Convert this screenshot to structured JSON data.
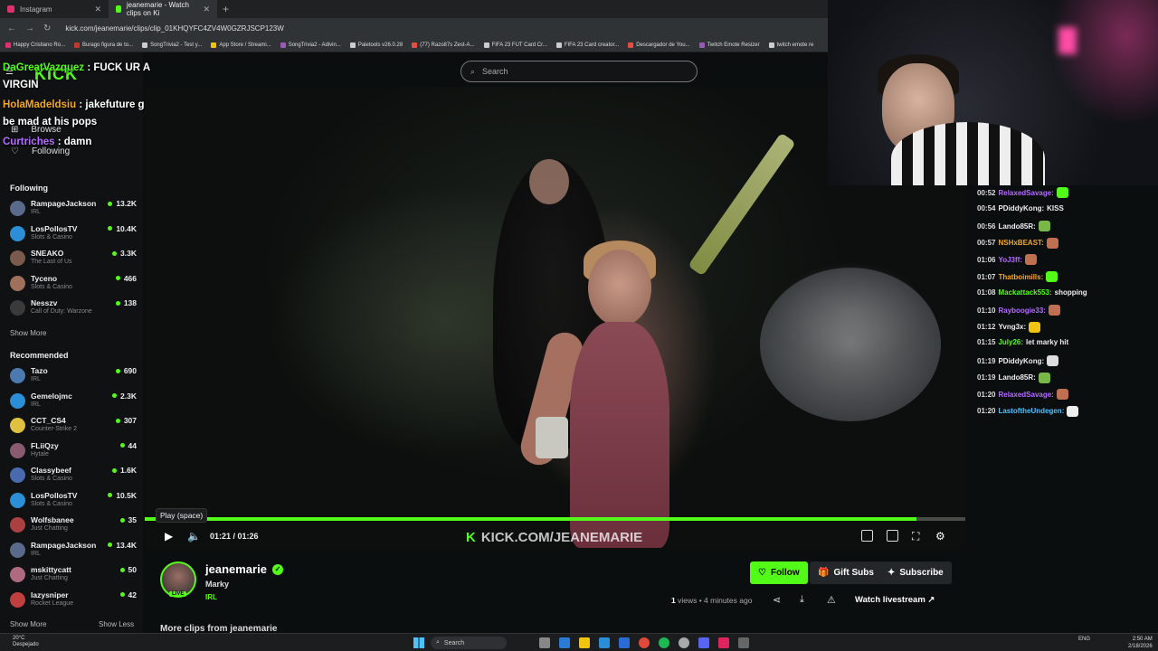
{
  "browser": {
    "tabs": [
      {
        "label": "Instagram",
        "color": "#e1306c"
      },
      {
        "label": "jeanemarie - Watch clips on Ki",
        "color": "#53fc18"
      }
    ],
    "url": "kick.com/jeanemarie/clips/clip_01KHQYFC4ZV4W0GZRJSCP123W",
    "bookmarks": [
      {
        "label": "Happy Cristiano Ro...",
        "color": "#e1306c"
      },
      {
        "label": "Burago figura de to...",
        "color": "#c0392b"
      },
      {
        "label": "SongTrivia2 - Test y...",
        "color": "#ccc"
      },
      {
        "label": "App Store / Streami...",
        "color": "#f1c40f"
      },
      {
        "label": "SongTrivia2 - Adivin...",
        "color": "#9b59b6"
      },
      {
        "label": "Paletools v26.0.28",
        "color": "#ccc"
      },
      {
        "label": "(77) Razo87s Zest-A...",
        "color": "#e74c3c"
      },
      {
        "label": "FIFA 23 FUT Card Cr...",
        "color": "#ccc"
      },
      {
        "label": "FIFA 23 Card creator...",
        "color": "#ccc"
      },
      {
        "label": "Descargador de You...",
        "color": "#e74c3c"
      },
      {
        "label": "Twitch Emote Resizer",
        "color": "#9b59b6"
      },
      {
        "label": "twitch emote re",
        "color": "#ccc"
      }
    ]
  },
  "overlay_chat": [
    {
      "user": "DaGreatVazquez",
      "text": " : FUCK UR A VIRGIN",
      "cls": "u1"
    },
    {
      "user": "HolaMadeldsiu",
      "text": " : jakefuture gonna be mad at his pops",
      "cls": "u2"
    },
    {
      "user": "Curtriches",
      "text": " : damn",
      "cls": "u3"
    }
  ],
  "sidebar": {
    "logo": "KICK",
    "browse": "Browse",
    "following_link": "Following",
    "following_title": "Following",
    "following": [
      {
        "name": "RampageJackson",
        "category": "IRL",
        "viewers": "13.2K",
        "color": "#5a6a8a"
      },
      {
        "name": "LosPollosTV",
        "category": "Slots & Casino",
        "viewers": "10.4K",
        "color": "#2a8fd6"
      },
      {
        "name": "SNEAKO",
        "category": "The Last of Us",
        "viewers": "3.3K",
        "color": "#7a5a4a"
      },
      {
        "name": "Tyceno",
        "category": "Slots & Casino",
        "viewers": "466",
        "color": "#a0705a"
      },
      {
        "name": "Nesszv",
        "category": "Call of Duty: Warzone",
        "viewers": "138",
        "color": "#3a3a3a"
      }
    ],
    "show_more": "Show More",
    "recommended_title": "Recommended",
    "recommended": [
      {
        "name": "Tazo",
        "category": "IRL",
        "viewers": "690",
        "color": "#4a7ab0"
      },
      {
        "name": "Gemelojmc",
        "category": "IRL",
        "viewers": "2.3K",
        "color": "#2a8fd6"
      },
      {
        "name": "CCT_CS4",
        "category": "Counter-Strike 2",
        "viewers": "307",
        "color": "#e0c040"
      },
      {
        "name": "FLiiQzy",
        "category": "Hytale",
        "viewers": "44",
        "color": "#8a5a70"
      },
      {
        "name": "Classybeef",
        "category": "Slots & Casino",
        "viewers": "1.6K",
        "color": "#4a6ab0"
      },
      {
        "name": "LosPollosTV",
        "category": "Slots & Casino",
        "viewers": "10.5K",
        "color": "#2a8fd6"
      },
      {
        "name": "Wolfsbanee",
        "category": "Just Chatting",
        "viewers": "35",
        "color": "#aa4040"
      },
      {
        "name": "RampageJackson",
        "category": "IRL",
        "viewers": "13.4K",
        "color": "#5a6a8a"
      },
      {
        "name": "mskittycatt",
        "category": "Just Chatting",
        "viewers": "50",
        "color": "#b06a80"
      },
      {
        "name": "lazysniper",
        "category": "Rocket League",
        "viewers": "42",
        "color": "#c04040"
      }
    ],
    "show_more2": "Show More",
    "show_less": "Show Less"
  },
  "search": {
    "placeholder": "Search"
  },
  "player": {
    "tooltip": "Play (space)",
    "time": "01:21 / 01:26",
    "progress_fraction": 0.94,
    "watermark": "KICK.COM/JEANEMARIE"
  },
  "channel": {
    "name": "jeanemarie",
    "clip_title": "Marky",
    "category": "IRL",
    "live_badge": "LIVE",
    "follow": "Follow",
    "gift": "Gift Subs",
    "subscribe": "Subscribe",
    "views_count": "1",
    "views_rest": " views • 4 minutes ago",
    "watch_live": "Watch livestream",
    "more_clips": "More clips from jeanemarie"
  },
  "chat": [
    {
      "time": "00:52",
      "user": "RelaxedSavage:",
      "text": "",
      "color": "#b46cff",
      "emote": "#53fc18"
    },
    {
      "time": "00:54",
      "user": "PDiddyKong:",
      "text": "KISS",
      "color": "#eee",
      "emote": ""
    },
    {
      "time": "00:56",
      "user": "Lando85R:",
      "text": "",
      "color": "#eee",
      "emote": "#7ab648"
    },
    {
      "time": "00:57",
      "user": "NSHxBEAST:",
      "text": "",
      "color": "#f4a724",
      "emote": "#c07050"
    },
    {
      "time": "01:06",
      "user": "YoJ3ff:",
      "text": "",
      "color": "#b46cff",
      "emote": "#c07050"
    },
    {
      "time": "01:07",
      "user": "Thatboimills:",
      "text": "",
      "color": "#f4a724",
      "emote": "#53fc18"
    },
    {
      "time": "01:08",
      "user": "Mackattack553:",
      "text": "shopping",
      "color": "#53fc18",
      "emote": ""
    },
    {
      "time": "01:10",
      "user": "Rayboogie33:",
      "text": "",
      "color": "#b46cff",
      "emote": "#c07050"
    },
    {
      "time": "01:12",
      "user": "Yvng3x:",
      "text": "",
      "color": "#eee",
      "emote": "#f1c40f"
    },
    {
      "time": "01:15",
      "user": "July26:",
      "text": "let marky hit",
      "color": "#53fc18",
      "emote": ""
    },
    {
      "time": "01:19",
      "user": "PDiddyKong:",
      "text": "",
      "color": "#eee",
      "emote": "#ddd"
    },
    {
      "time": "01:19",
      "user": "Lando85R:",
      "text": "",
      "color": "#eee",
      "emote": "#7ab648"
    },
    {
      "time": "01:20",
      "user": "RelaxedSavage:",
      "text": "",
      "color": "#b46cff",
      "emote": "#c07050"
    },
    {
      "time": "01:20",
      "user": "LastoftheUndegen:",
      "text": "",
      "color": "#4cc2ff",
      "emote": "#eee"
    }
  ],
  "taskbar": {
    "temp": "20°C",
    "weather": "Despejado",
    "search": "Search",
    "lang": "ENG",
    "time": "2:50 AM",
    "date": "2/18/2026"
  },
  "colors": {
    "accent": "#53fc18"
  }
}
